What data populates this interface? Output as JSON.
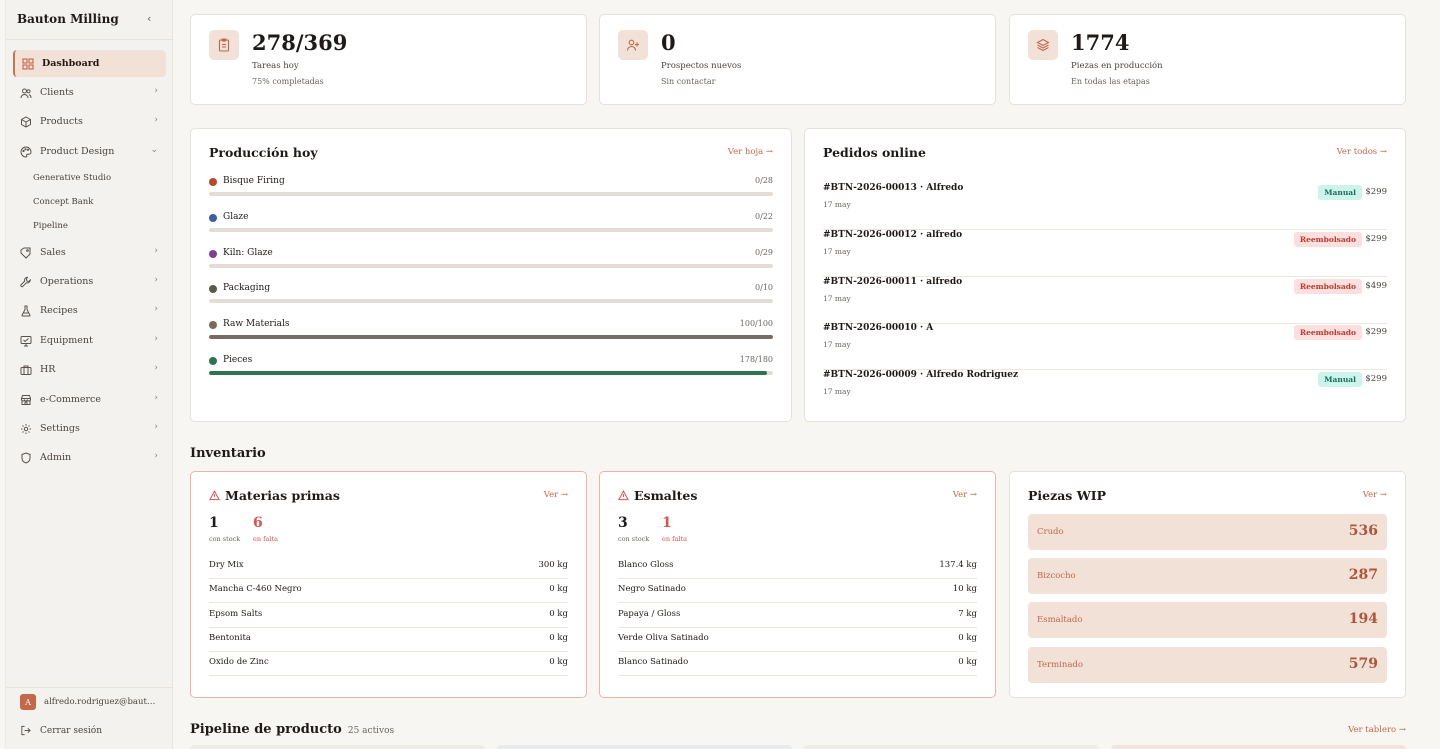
{
  "sidebar": {
    "brand": "Bauton Milling",
    "collapse_icon": "‹",
    "items": [
      {
        "label": "Dashboard",
        "icon": "dashboard-icon"
      },
      {
        "label": "Clients",
        "icon": "users-icon"
      },
      {
        "label": "Products",
        "icon": "box-icon"
      },
      {
        "label": "Product Design",
        "icon": "palette-icon"
      },
      {
        "label": "Sales",
        "icon": "tag-icon"
      },
      {
        "label": "Operations",
        "icon": "wrench-icon"
      },
      {
        "label": "Recipes",
        "icon": "flask-icon"
      },
      {
        "label": "Equipment",
        "icon": "monitor-icon"
      },
      {
        "label": "HR",
        "icon": "briefcase-icon"
      },
      {
        "label": "e-Commerce",
        "icon": "store-icon"
      },
      {
        "label": "Settings",
        "icon": "gear-icon"
      },
      {
        "label": "Admin",
        "icon": "shield-icon"
      }
    ],
    "sub_items": [
      "Generative Studio",
      "Concept Bank",
      "Pipeline"
    ],
    "user_initial": "A",
    "user_email": "alfredo.rodriguez@bautonmilling.com",
    "logout_label": "Cerrar sesión"
  },
  "stats": [
    {
      "value": "278/369",
      "label": "Tareas hoy",
      "sub": "75% completadas",
      "icon": "clipboard-icon"
    },
    {
      "value": "0",
      "label": "Prospectos nuevos",
      "sub": "Sin contactar",
      "icon": "user-plus-icon"
    },
    {
      "value": "1774",
      "label": "Piezas en producción",
      "sub": "En todas las etapas",
      "icon": "layers-icon"
    }
  ],
  "production": {
    "title": "Producción hoy",
    "link": "Ver hoja →",
    "rows": [
      {
        "name": "Bisque Firing",
        "count": "0/28",
        "progress": 0,
        "color": "#b5482e"
      },
      {
        "name": "Glaze",
        "count": "0/22",
        "progress": 0,
        "color": "#3a5fa8"
      },
      {
        "name": "Kiln: Glaze",
        "count": "0/29",
        "progress": 0,
        "color": "#7a3f8f"
      },
      {
        "name": "Packaging",
        "count": "0/10",
        "progress": 0,
        "color": "#5c5a4a"
      },
      {
        "name": "Raw Materials",
        "count": "100/100",
        "progress": 1.0,
        "color": "#7a6b62"
      },
      {
        "name": "Pieces",
        "count": "178/180",
        "progress": 0.989,
        "color": "#2f7452"
      }
    ]
  },
  "orders": {
    "title": "Pedidos online",
    "link": "Ver todos →",
    "rows": [
      {
        "id": "#BTN-2026-00013 · Alfredo",
        "date": "17 may",
        "status": "Manual",
        "type": "manual",
        "price": "$299"
      },
      {
        "id": "#BTN-2026-00012 · alfredo",
        "date": "17 may",
        "status": "Reembolsado",
        "type": "refund",
        "price": "$299"
      },
      {
        "id": "#BTN-2026-00011 · alfredo",
        "date": "17 may",
        "status": "Reembolsado",
        "type": "refund",
        "price": "$499"
      },
      {
        "id": "#BTN-2026-00010 · A",
        "date": "17 may",
        "status": "Reembolsado",
        "type": "refund",
        "price": "$299"
      },
      {
        "id": "#BTN-2026-00009 · Alfredo Rodriguez",
        "date": "17 may",
        "status": "Manual",
        "type": "manual",
        "price": "$299"
      }
    ]
  },
  "inventory": {
    "title": "Inventario",
    "raw": {
      "title": "Materias primas",
      "link": "Ver →",
      "stock": "1",
      "stock_label": "con stock",
      "missing": "6",
      "missing_label": "en falta",
      "rows": [
        {
          "name": "Dry Mix",
          "qty": "300 kg"
        },
        {
          "name": "Mancha C-460 Negro",
          "qty": "0 kg"
        },
        {
          "name": "Epsom Salts",
          "qty": "0 kg"
        },
        {
          "name": "Bentonita",
          "qty": "0 kg"
        },
        {
          "name": "Oxido de Zinc",
          "qty": "0 kg"
        }
      ]
    },
    "glazes": {
      "title": "Esmaltes",
      "link": "Ver →",
      "stock": "3",
      "stock_label": "con stock",
      "missing": "1",
      "missing_label": "en falta",
      "rows": [
        {
          "name": "Blanco Gloss",
          "qty": "137.4 kg"
        },
        {
          "name": "Negro Satinado",
          "qty": "10 kg"
        },
        {
          "name": "Papaya / Gloss",
          "qty": "7 kg"
        },
        {
          "name": "Verde Oliva Satinado",
          "qty": "0 kg"
        },
        {
          "name": "Blanco Satinado",
          "qty": "0 kg"
        }
      ]
    },
    "wip": {
      "title": "Piezas WIP",
      "link": "Ver →",
      "rows": [
        {
          "name": "Crudo",
          "value": "536"
        },
        {
          "name": "Bizcocho",
          "value": "287"
        },
        {
          "name": "Esmaltado",
          "value": "194"
        },
        {
          "name": "Terminado",
          "value": "579"
        }
      ]
    }
  },
  "pipeline": {
    "title": "Pipeline de producto",
    "count": "25 activos",
    "link": "Ver tablero →"
  },
  "colors": {
    "accent": "#c4684a",
    "alert": "#d9534f",
    "accent_soft": "#f1e1d6"
  }
}
